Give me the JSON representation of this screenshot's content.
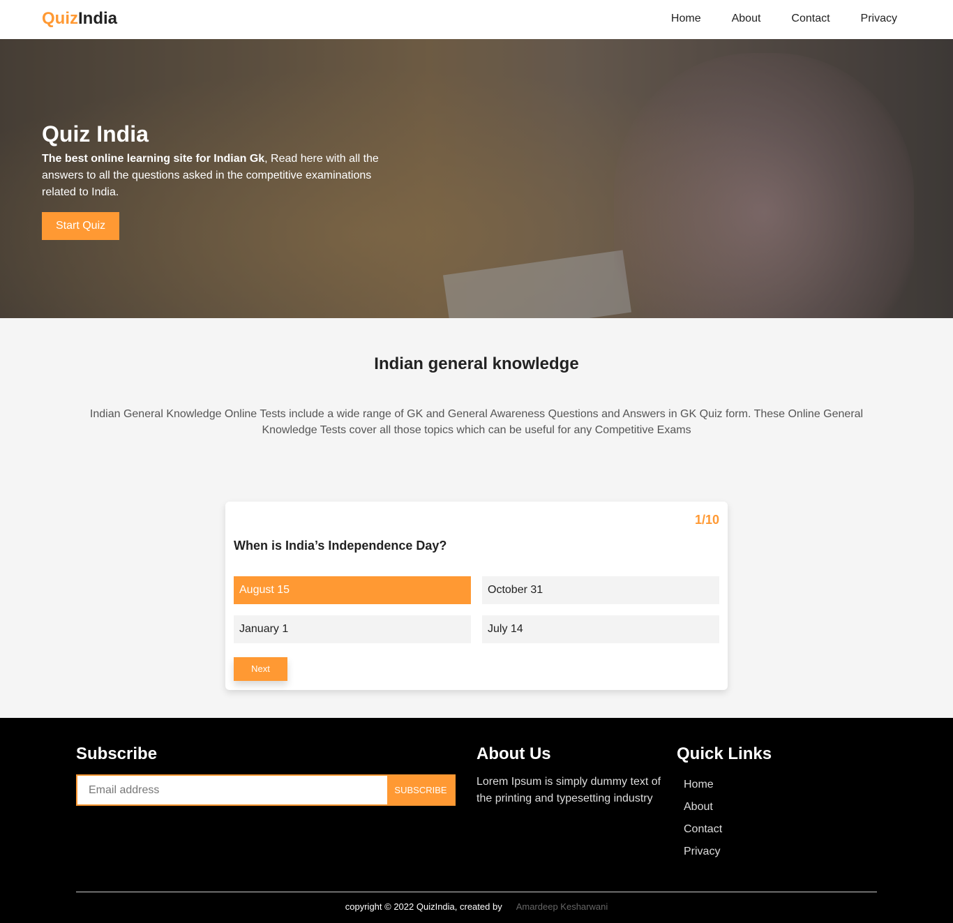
{
  "nav": {
    "logo_part1": "Quiz",
    "logo_part2": "India",
    "links": [
      "Home",
      "About",
      "Contact",
      "Privacy"
    ]
  },
  "hero": {
    "title": "Quiz India",
    "text_bold": "The best online learning site for Indian Gk",
    "text_rest": ", Read here with all the answers to all the questions asked in the competitive examinations related to India.",
    "button_label": "Start Quiz"
  },
  "section": {
    "title": "Indian general knowledge",
    "description": "Indian General Knowledge Online Tests include a wide range of GK and General Awareness Questions and Answers in GK Quiz form. These Online General Knowledge Tests cover all those topics which can be useful for any Competitive Exams"
  },
  "quiz": {
    "counter": "1/10",
    "question": "When is India’s Independence Day?",
    "options": [
      "August 15",
      "October 31",
      "January 1",
      "July 14"
    ],
    "selected_option": "August 15",
    "next_label": "Next"
  },
  "footer": {
    "subscribe_heading": "Subscribe",
    "email_placeholder": "Email address",
    "subscribe_button": "SUBSCRIBE",
    "about_heading": "About Us",
    "about_text": "Lorem Ipsum is simply dummy text of the printing and typesetting industry",
    "links_heading": "Quick Links",
    "links": [
      "Home",
      "About",
      "Contact",
      "Privacy"
    ],
    "copyright": "copyright © 2022 QuizIndia, created by",
    "author": "Amardeep Kesharwani"
  },
  "colors": {
    "accent": "#ff9933",
    "footer_bg": "#000000",
    "page_bg": "#f5f5f5"
  }
}
